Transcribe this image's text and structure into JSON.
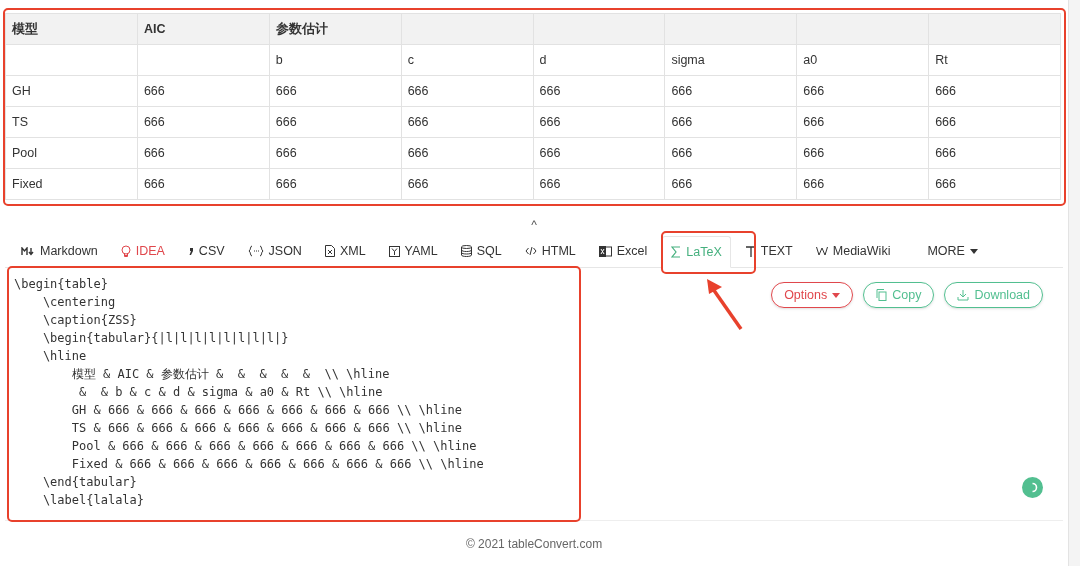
{
  "table": {
    "header": [
      "模型",
      "AIC",
      "参数估计"
    ],
    "rows": [
      [
        "",
        "",
        "b",
        "c",
        "d",
        "sigma",
        "a0",
        "Rt"
      ],
      [
        "GH",
        "666",
        "666",
        "666",
        "666",
        "666",
        "666",
        "666"
      ],
      [
        "TS",
        "666",
        "666",
        "666",
        "666",
        "666",
        "666",
        "666"
      ],
      [
        "Pool",
        "666",
        "666",
        "666",
        "666",
        "666",
        "666",
        "666"
      ],
      [
        "Fixed",
        "666",
        "666",
        "666",
        "666",
        "666",
        "666",
        "666"
      ]
    ]
  },
  "collapse_toggle": "^",
  "tabs": [
    {
      "label": "Markdown",
      "kind": "format",
      "selected": false
    },
    {
      "label": "IDEA",
      "kind": "promo",
      "selected": false
    },
    {
      "label": "CSV",
      "kind": "format",
      "selected": false
    },
    {
      "label": "JSON",
      "kind": "format",
      "selected": false
    },
    {
      "label": "XML",
      "kind": "format",
      "selected": false
    },
    {
      "label": "YAML",
      "kind": "format",
      "selected": false
    },
    {
      "label": "SQL",
      "kind": "format",
      "selected": false
    },
    {
      "label": "HTML",
      "kind": "format",
      "selected": false
    },
    {
      "label": "Excel",
      "kind": "format",
      "selected": false
    },
    {
      "label": "LaTeX",
      "kind": "format",
      "selected": true
    },
    {
      "label": "TEXT",
      "kind": "format",
      "selected": false
    },
    {
      "label": "MediaWiki",
      "kind": "format",
      "selected": false
    },
    {
      "label": "MORE",
      "kind": "menu",
      "selected": false
    }
  ],
  "code": "\\begin{table}\n    \\centering\n    \\caption{ZSS}\n    \\begin{tabular}{|l|l|l|l|l|l|l|l|}\n    \\hline\n        模型 & AIC & 参数估计 &  &  &  &  &  \\\\ \\hline\n         &  & b & c & d & sigma & a0 & Rt \\\\ \\hline\n        GH & 666 & 666 & 666 & 666 & 666 & 666 & 666 \\\\ \\hline\n        TS & 666 & 666 & 666 & 666 & 666 & 666 & 666 \\\\ \\hline\n        Pool & 666 & 666 & 666 & 666 & 666 & 666 & 666 \\\\ \\hline\n        Fixed & 666 & 666 & 666 & 666 & 666 & 666 & 666 \\\\ \\hline\n    \\end{tabular}\n    \\label{lalala}",
  "buttons": [
    {
      "label": "Options",
      "kind": "dropdown"
    },
    {
      "label": "Copy",
      "kind": "copy"
    },
    {
      "label": "Download",
      "kind": "download"
    }
  ],
  "footer": "© 2021 tableConvert.com"
}
